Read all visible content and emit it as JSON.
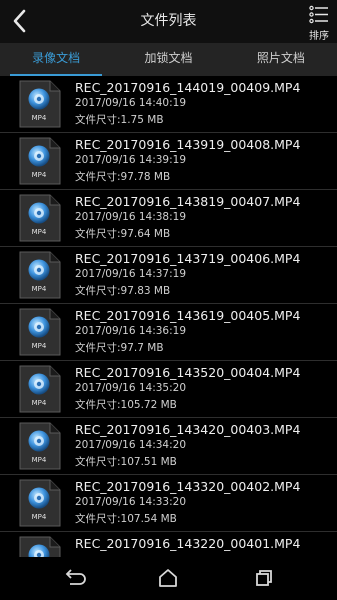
{
  "header": {
    "title": "文件列表",
    "sort_label": "排序"
  },
  "tabs": [
    {
      "label": "录像文档",
      "active": true
    },
    {
      "label": "加锁文档",
      "active": false
    },
    {
      "label": "照片文档",
      "active": false
    }
  ],
  "files": [
    {
      "name": "REC_20170916_144019_00409.MP4",
      "date": "2017/09/16 14:40:19",
      "size": "文件尺寸:1.75 MB",
      "type": "MP4"
    },
    {
      "name": "REC_20170916_143919_00408.MP4",
      "date": "2017/09/16 14:39:19",
      "size": "文件尺寸:97.78 MB",
      "type": "MP4"
    },
    {
      "name": "REC_20170916_143819_00407.MP4",
      "date": "2017/09/16 14:38:19",
      "size": "文件尺寸:97.64 MB",
      "type": "MP4"
    },
    {
      "name": "REC_20170916_143719_00406.MP4",
      "date": "2017/09/16 14:37:19",
      "size": "文件尺寸:97.83 MB",
      "type": "MP4"
    },
    {
      "name": "REC_20170916_143619_00405.MP4",
      "date": "2017/09/16 14:36:19",
      "size": "文件尺寸:97.7 MB",
      "type": "MP4"
    },
    {
      "name": "REC_20170916_143520_00404.MP4",
      "date": "2017/09/16 14:35:20",
      "size": "文件尺寸:105.72 MB",
      "type": "MP4"
    },
    {
      "name": "REC_20170916_143420_00403.MP4",
      "date": "2017/09/16 14:34:20",
      "size": "文件尺寸:107.51 MB",
      "type": "MP4"
    },
    {
      "name": "REC_20170916_143320_00402.MP4",
      "date": "2017/09/16 14:33:20",
      "size": "文件尺寸:107.54 MB",
      "type": "MP4"
    },
    {
      "name": "REC_20170916_143220_00401.MP4",
      "date": "",
      "size": "",
      "type": "MP4"
    }
  ],
  "icons": {
    "back": "chevron-left-icon",
    "sort": "list-sort-icon",
    "file": "mp4-file-icon",
    "nav_back": "nav-back-icon",
    "nav_home": "nav-home-icon",
    "nav_recent": "nav-recent-icon"
  },
  "colors": {
    "accent": "#3a9bd5",
    "titlebar": "#101010",
    "tabbar": "#242424",
    "background": "#000000"
  }
}
